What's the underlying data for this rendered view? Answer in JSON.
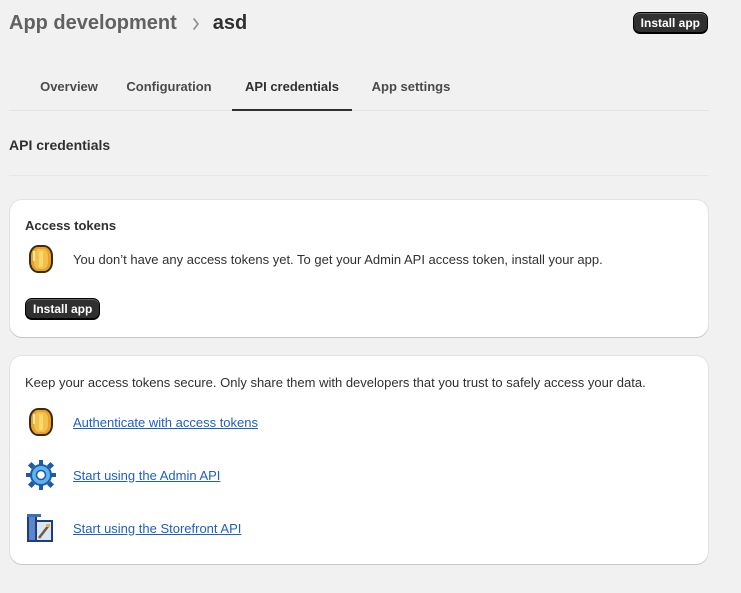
{
  "header": {
    "breadcrumb_parent": "App development",
    "breadcrumb_current": "asd",
    "install_button": "Install app"
  },
  "tabs": [
    {
      "label": "Overview",
      "active": false
    },
    {
      "label": "Configuration",
      "active": false
    },
    {
      "label": "API credentials",
      "active": true
    },
    {
      "label": "App settings",
      "active": false
    }
  ],
  "section": {
    "title": "API credentials"
  },
  "access_tokens_card": {
    "heading": "Access tokens",
    "icon": "coin-icon",
    "message": "You don’t have any access tokens yet. To get your Admin API access token, install your app.",
    "install_button": "Install app"
  },
  "docs_card": {
    "intro": "Keep your access tokens secure. Only share them with developers that you trust to safely access your data.",
    "links": [
      {
        "icon": "coin-icon",
        "label": "Authenticate with access tokens"
      },
      {
        "icon": "gear-icon",
        "label": "Start using the Admin API"
      },
      {
        "icon": "storefront-icon",
        "label": "Start using the Storefront API"
      }
    ]
  },
  "colors": {
    "page_background": "#f1f1f1",
    "card_background": "#ffffff",
    "button_dark": "#303030",
    "link": "#1f5fbf"
  }
}
